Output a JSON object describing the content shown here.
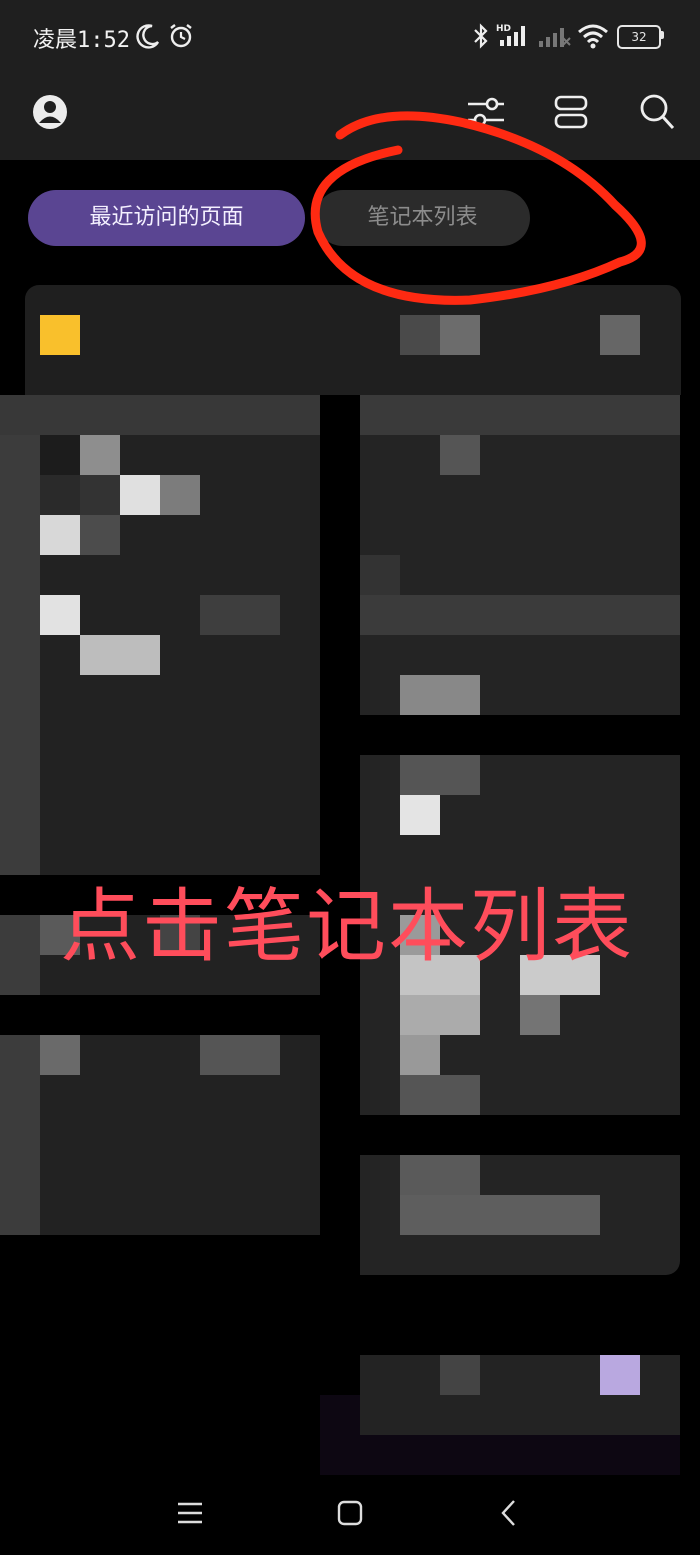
{
  "status_bar": {
    "time": "凌晨1:52",
    "battery": "32",
    "icons": [
      "moon-icon",
      "alarm-icon",
      "bluetooth-icon",
      "hd-signal-icon",
      "signal-icon",
      "wifi-icon",
      "battery-icon"
    ]
  },
  "app_bar": {
    "icons": [
      "avatar-icon",
      "filter-sliders-icon",
      "layout-toggle-icon",
      "search-icon"
    ]
  },
  "tabs": {
    "recent_label": "最近访问的页面",
    "notebooks_label": "笔记本列表"
  },
  "annotation": {
    "instruction": "点击笔记本列表",
    "color": "#ff4d5b",
    "circle_color": "#ff2a12"
  },
  "colors": {
    "accent": "#5a4592",
    "background": "#000000",
    "surface": "#1f1f1f"
  },
  "nav_bar": {
    "icons": [
      "menu-icon",
      "home-icon",
      "back-icon"
    ]
  }
}
